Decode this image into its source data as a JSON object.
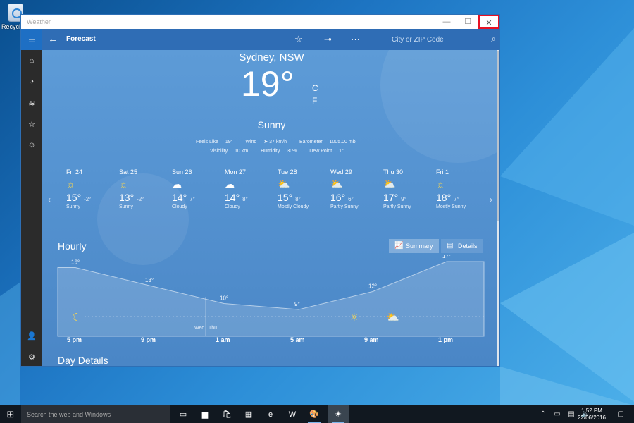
{
  "desktop": {
    "recycle_bin_label": "Recycle Bin"
  },
  "window": {
    "title": "Weather",
    "minimize_glyph": "—",
    "maximize_glyph": "☐",
    "close_glyph": "✕"
  },
  "appbar": {
    "back_glyph": "←",
    "heading": "Forecast",
    "favorite_glyph": "☆",
    "pin_glyph": "⊸",
    "more_glyph": "···",
    "search_placeholder": "City or ZIP Code",
    "search_glyph": "⌕"
  },
  "nav": {
    "menu_glyph": "☰",
    "items": [
      {
        "name": "home-icon",
        "glyph": "⌂"
      },
      {
        "name": "radar-icon",
        "glyph": "◔"
      },
      {
        "name": "historical-icon",
        "glyph": "≋"
      },
      {
        "name": "favorites-icon",
        "glyph": "☆"
      },
      {
        "name": "life-icon",
        "glyph": "☺"
      }
    ],
    "account_glyph": "👤",
    "settings_glyph": "⚙"
  },
  "current": {
    "city": "Sydney, NSW",
    "temp": "19°",
    "unit_c": "C",
    "unit_f": "F",
    "condition": "Sunny",
    "details_row1": [
      {
        "label": "Feels Like",
        "value": "19°"
      },
      {
        "label": "Wind",
        "value": "➤ 37 km/h"
      },
      {
        "label": "Barometer",
        "value": "1005.00 mb"
      }
    ],
    "details_row2": [
      {
        "label": "Visibility",
        "value": "10 km"
      },
      {
        "label": "Humidity",
        "value": "30%"
      },
      {
        "label": "Dew Point",
        "value": "1°"
      }
    ]
  },
  "forecast": [
    {
      "day": "Fri 24",
      "icon": "sun",
      "high": "15°",
      "low": "-2°",
      "cond": "Sunny"
    },
    {
      "day": "Sat 25",
      "icon": "sun",
      "high": "13°",
      "low": "-2°",
      "cond": "Sunny"
    },
    {
      "day": "Sun 26",
      "icon": "cloud",
      "high": "14°",
      "low": "7°",
      "cond": "Cloudy"
    },
    {
      "day": "Mon 27",
      "icon": "cloud",
      "high": "14°",
      "low": "8°",
      "cond": "Cloudy"
    },
    {
      "day": "Tue 28",
      "icon": "partly",
      "high": "15°",
      "low": "8°",
      "cond": "Mostly Cloudy"
    },
    {
      "day": "Wed 29",
      "icon": "partly",
      "high": "16°",
      "low": "6°",
      "cond": "Partly Sunny"
    },
    {
      "day": "Thu 30",
      "icon": "partly",
      "high": "17°",
      "low": "9°",
      "cond": "Partly Sunny"
    },
    {
      "day": "Fri 1",
      "icon": "sun",
      "high": "18°",
      "low": "7°",
      "cond": "Mostly Sunny"
    }
  ],
  "hourly": {
    "title": "Hourly",
    "summary_label": "Summary",
    "details_label": "Details",
    "day_split": [
      "Wed",
      "Thu"
    ],
    "time_labels": [
      "5 pm",
      "9 pm",
      "1 am",
      "5 am",
      "9 am",
      "1 pm"
    ]
  },
  "chart_data": {
    "type": "area",
    "points": [
      {
        "temp": 16,
        "label": "16°"
      },
      {
        "temp": 13,
        "label": "13°"
      },
      {
        "temp": 10,
        "label": "10°"
      },
      {
        "temp": 9,
        "label": "9°"
      },
      {
        "temp": 12,
        "label": "12°"
      },
      {
        "temp": 17,
        "label": "17°"
      }
    ],
    "ylim": [
      0,
      20
    ]
  },
  "day_details": {
    "title": "Day Details"
  },
  "taskbar": {
    "start_glyph": "⊞",
    "search_placeholder": "Search the web and Windows",
    "apps": [
      {
        "name": "task-view-icon",
        "glyph": "▭"
      },
      {
        "name": "file-explorer-icon",
        "glyph": "▆"
      },
      {
        "name": "store-icon",
        "glyph": "🛍"
      },
      {
        "name": "calendar-icon",
        "glyph": "▦"
      },
      {
        "name": "edge-icon",
        "glyph": "e"
      },
      {
        "name": "word-icon",
        "glyph": "W"
      },
      {
        "name": "paint-icon",
        "glyph": "🎨"
      },
      {
        "name": "weather-icon",
        "glyph": "☀"
      }
    ],
    "tray": [
      {
        "name": "chevron-up-icon",
        "glyph": "⌃"
      },
      {
        "name": "battery-icon",
        "glyph": "▭"
      },
      {
        "name": "message-icon",
        "glyph": "▤"
      },
      {
        "name": "volume-icon",
        "glyph": "🔈"
      }
    ],
    "time": "1:52 PM",
    "date": "22/06/2016",
    "notification_glyph": "▢"
  },
  "colors": {
    "accent": "#2f6db5",
    "close_highlight": "#e81123",
    "sun": "#ffd84a"
  }
}
